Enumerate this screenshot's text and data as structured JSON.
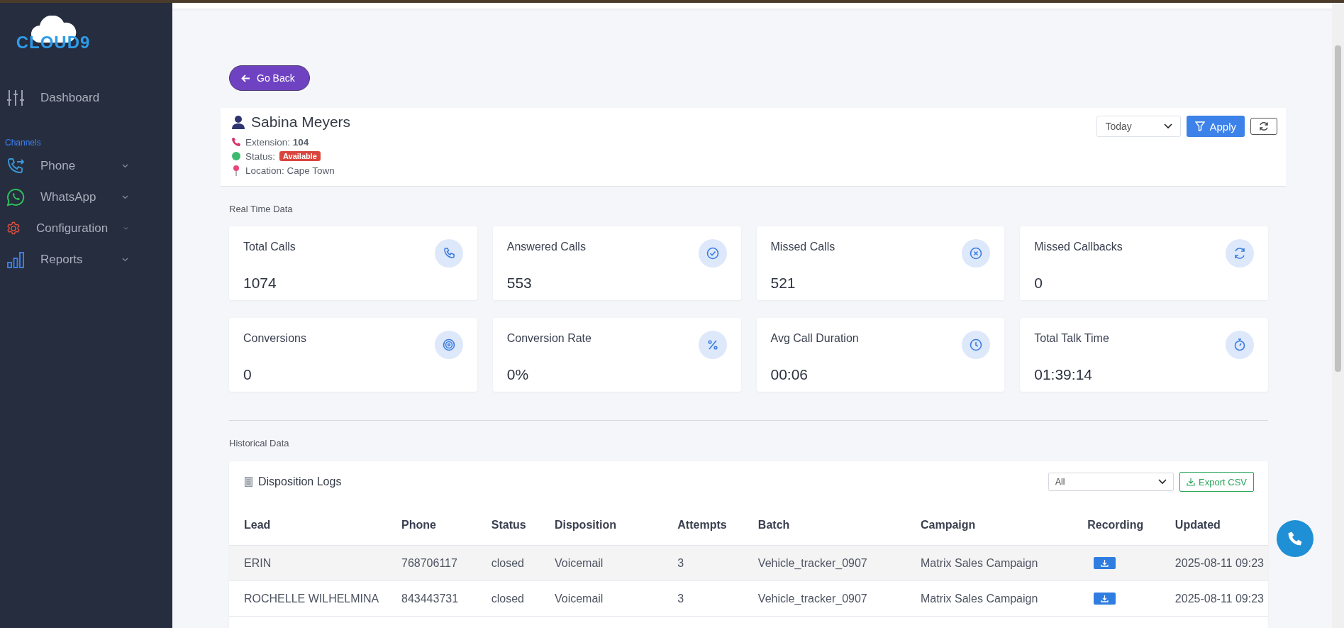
{
  "sidebar": {
    "logo": "CLOUD9",
    "items": [
      {
        "label": "Dashboard",
        "kind": "link"
      },
      {
        "label": "Channels",
        "kind": "section"
      },
      {
        "label": "Phone",
        "kind": "menu",
        "expanded": false
      },
      {
        "label": "WhatsApp",
        "kind": "menu",
        "expanded": false
      },
      {
        "label": "Configuration",
        "kind": "menu",
        "expanded": false
      },
      {
        "label": "Reports",
        "kind": "menu",
        "expanded": false
      }
    ]
  },
  "go_back": "Go Back",
  "profile": {
    "name": "Sabina Meyers",
    "extension_label": "Extension:",
    "extension": "104",
    "status_label": "Status:",
    "status": "Available",
    "location": "Location: Cape Town"
  },
  "filters": {
    "period": "Today",
    "apply": "Apply"
  },
  "realtime": {
    "title": "Real Time Data",
    "cards": [
      {
        "label": "Total Calls",
        "value": "1074"
      },
      {
        "label": "Answered Calls",
        "value": "553"
      },
      {
        "label": "Missed Calls",
        "value": "521"
      },
      {
        "label": "Missed Callbacks",
        "value": "0"
      },
      {
        "label": "Conversions",
        "value": "0"
      },
      {
        "label": "Conversion Rate",
        "value": "0%"
      },
      {
        "label": "Avg Call Duration",
        "value": "00:06"
      },
      {
        "label": "Total Talk Time",
        "value": "01:39:14"
      }
    ]
  },
  "historical": {
    "title": "Historical Data",
    "logs": {
      "title": "Disposition Logs",
      "filter": "All",
      "export": "Export CSV",
      "columns": [
        "Lead",
        "Phone",
        "Status",
        "Disposition",
        "Attempts",
        "Batch",
        "Campaign",
        "Recording",
        "Updated"
      ],
      "rows": [
        {
          "lead": "ERIN",
          "phone": "768706117",
          "status": "closed",
          "disposition": "Voicemail",
          "attempts": "3",
          "batch": "Vehicle_tracker_0907",
          "campaign": "Matrix Sales Campaign",
          "updated": "2025-08-11 09:23"
        },
        {
          "lead": "ROCHELLE WILHELMINA",
          "phone": "843443731",
          "status": "closed",
          "disposition": "Voicemail",
          "attempts": "3",
          "batch": "Vehicle_tracker_0907",
          "campaign": "Matrix Sales Campaign",
          "updated": "2025-08-11 09:23"
        }
      ]
    }
  }
}
